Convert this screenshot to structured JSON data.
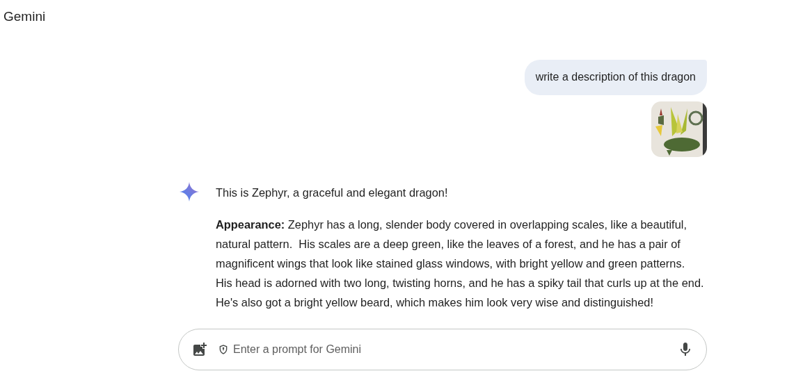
{
  "app_title": "Gemini",
  "user_message": {
    "text": "write a description of this dragon"
  },
  "response": {
    "paragraphs": [
      "This is Zephyr, a graceful and elegant dragon!",
      "**Appearance:** Zephyr has a long, slender body covered in overlapping scales, like a beautiful, natural pattern.  His scales are a deep green, like the leaves of a forest, and he has a pair of magnificent wings that look like stained glass windows, with bright yellow and green patterns.  His head is adorned with two long, twisting horns, and he has a spiky tail that curls up at the end. He's also got a bright yellow beard, which makes him look very wise and distinguished!"
    ]
  },
  "prompt_field": {
    "placeholder": "Enter a prompt for Gemini"
  }
}
